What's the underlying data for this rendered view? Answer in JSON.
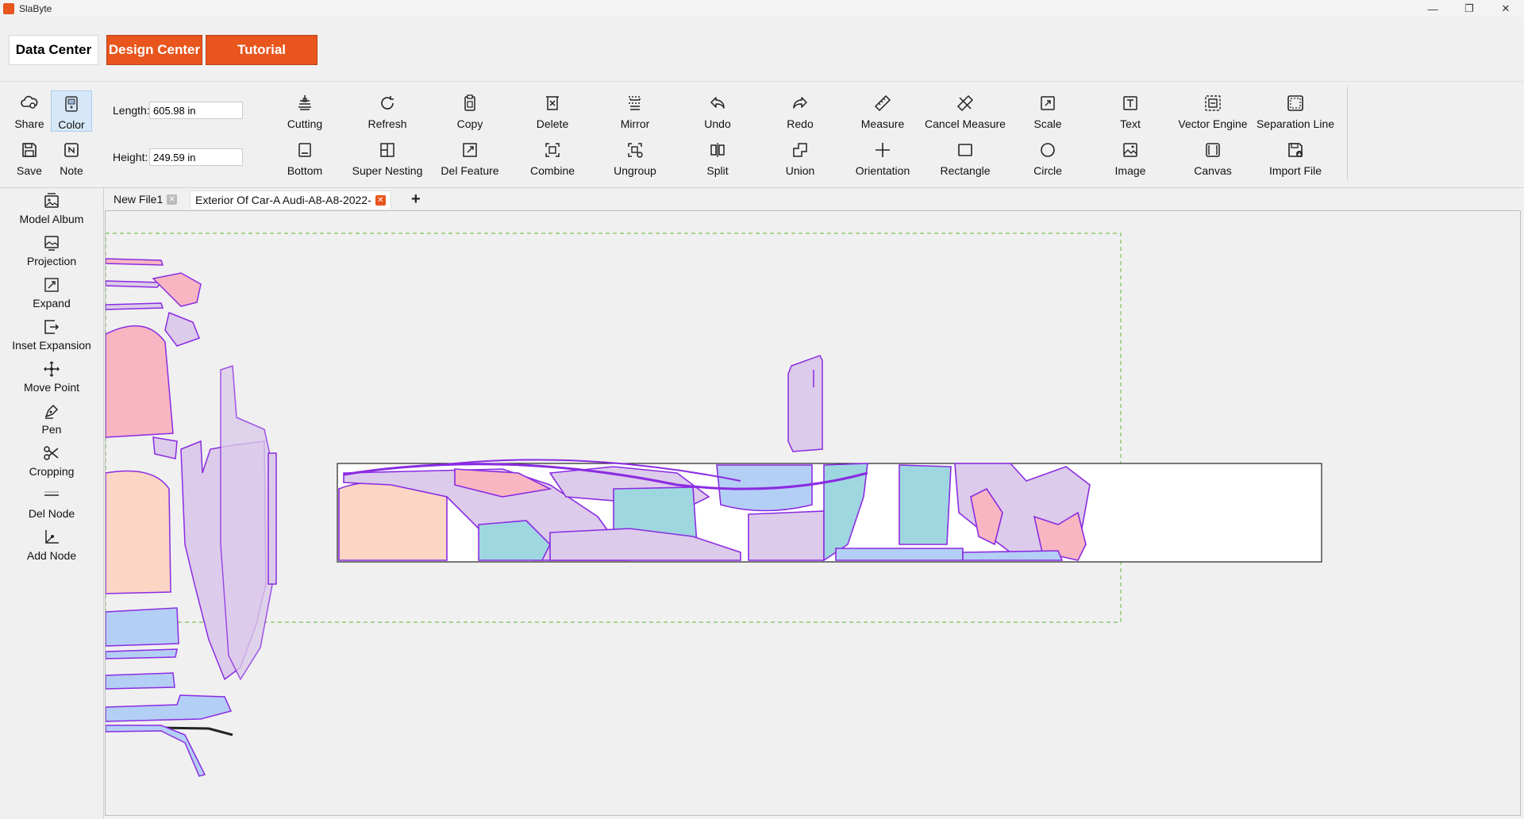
{
  "window": {
    "title": "SlaByte",
    "controls": [
      "—",
      "❐",
      "✕"
    ]
  },
  "nav": {
    "data_center": "Data Center",
    "design_center": "Design Center",
    "tutorial": "Tutorial"
  },
  "toolbar": {
    "left_tools": {
      "share": "Share",
      "color": "Color",
      "save": "Save",
      "note": "Note"
    },
    "length_label": "Length:",
    "length_value": "605.98 in",
    "height_label": "Height:",
    "height_value": "249.59 in",
    "row1": [
      "Cutting",
      "Refresh",
      "Copy",
      "Delete",
      "Mirror",
      "Undo",
      "Redo",
      "Measure",
      "Cancel Measure",
      "Scale",
      "Text",
      "Vector Engine",
      "Separation Line"
    ],
    "row2": [
      "Bottom",
      "Super Nesting",
      "Del Feature",
      "Combine",
      "Ungroup",
      "Split",
      "Union",
      "Orientation",
      "Rectangle",
      "Circle",
      "Image",
      "Canvas",
      "Import File"
    ]
  },
  "sidebar": {
    "items": [
      "Model Album",
      "Projection",
      "Expand",
      "Inset Expansion",
      "Move Point",
      "Pen",
      "Cropping",
      "Del Node",
      "Add Node"
    ]
  },
  "tabs": {
    "items": [
      {
        "label": "New File1"
      },
      {
        "label": "Exterior Of Car-A Audi-A8-A8-2022-"
      }
    ],
    "add_label": "+"
  },
  "colors": {
    "accent": "#e8551d",
    "piece_outline": "#8a2be2",
    "piece_pink": "#f7b6c2",
    "piece_peach": "#fbd6c4",
    "piece_lavender": "#dccbea",
    "piece_blue": "#b4cff5",
    "piece_cyan": "#9fd7e0",
    "material_guide": "#7cc05a"
  }
}
